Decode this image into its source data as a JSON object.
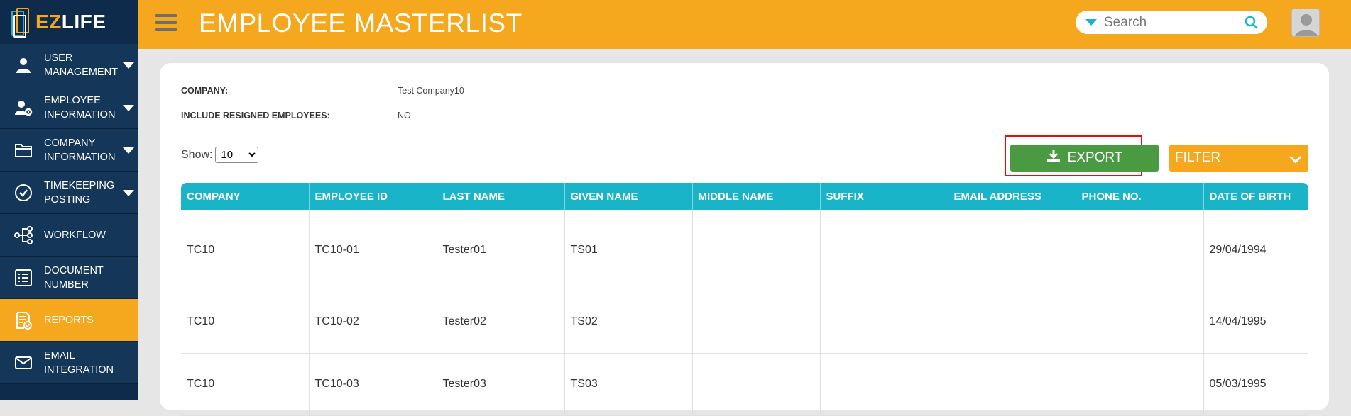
{
  "app": {
    "logo_prefix": "EZ",
    "logo_suffix": "LIFE"
  },
  "sidebar": {
    "items": [
      {
        "label": "USER MANAGEMENT",
        "icon": "user-icon",
        "caret": true,
        "active": false
      },
      {
        "label": "EMPLOYEE INFORMATION",
        "icon": "user-gear-icon",
        "caret": true,
        "active": false
      },
      {
        "label": "COMPANY INFORMATION",
        "icon": "folder-icon",
        "caret": true,
        "active": false
      },
      {
        "label": "TIMEKEEPING POSTING",
        "icon": "check-circle-icon",
        "caret": true,
        "active": false
      },
      {
        "label": "WORKFLOW",
        "icon": "workflow-icon",
        "caret": false,
        "active": false
      },
      {
        "label": "DOCUMENT NUMBER",
        "icon": "document-list-icon",
        "caret": false,
        "active": false
      },
      {
        "label": "REPORTS",
        "icon": "report-icon",
        "caret": false,
        "active": true
      },
      {
        "label": "EMAIL INTEGRATION",
        "icon": "envelope-icon",
        "caret": false,
        "active": false
      }
    ]
  },
  "header": {
    "title": "EMPLOYEE MASTERLIST",
    "search_placeholder": "Search"
  },
  "report": {
    "company_label": "COMPANY:",
    "company_value": "Test Company10",
    "resigned_label": "INCLUDE RESIGNED EMPLOYEES:",
    "resigned_value": "NO",
    "show_label": "Show:",
    "show_value": "10",
    "export_label": "EXPORT",
    "filter_label": "FILTER"
  },
  "table": {
    "columns": [
      "COMPANY",
      "EMPLOYEE ID",
      "LAST NAME",
      "GIVEN NAME",
      "MIDDLE NAME",
      "SUFFIX",
      "EMAIL ADDRESS",
      "PHONE NO.",
      "DATE OF BIRTH"
    ],
    "rows": [
      [
        "TC10",
        "TC10-01",
        "Tester01",
        "TS01",
        "",
        "",
        "",
        "",
        "29/04/1994"
      ],
      [
        "TC10",
        "TC10-02",
        "Tester02",
        "TS02",
        "",
        "",
        "",
        "",
        "14/04/1995"
      ],
      [
        "TC10",
        "TC10-03",
        "Tester03",
        "TS03",
        "",
        "",
        "",
        "",
        "05/03/1995"
      ]
    ]
  },
  "colors": {
    "accent": "#f5a81d",
    "sidebar": "#143659",
    "table_header": "#1ab4c8",
    "export": "#4a9a41",
    "highlight": "#e01010"
  }
}
